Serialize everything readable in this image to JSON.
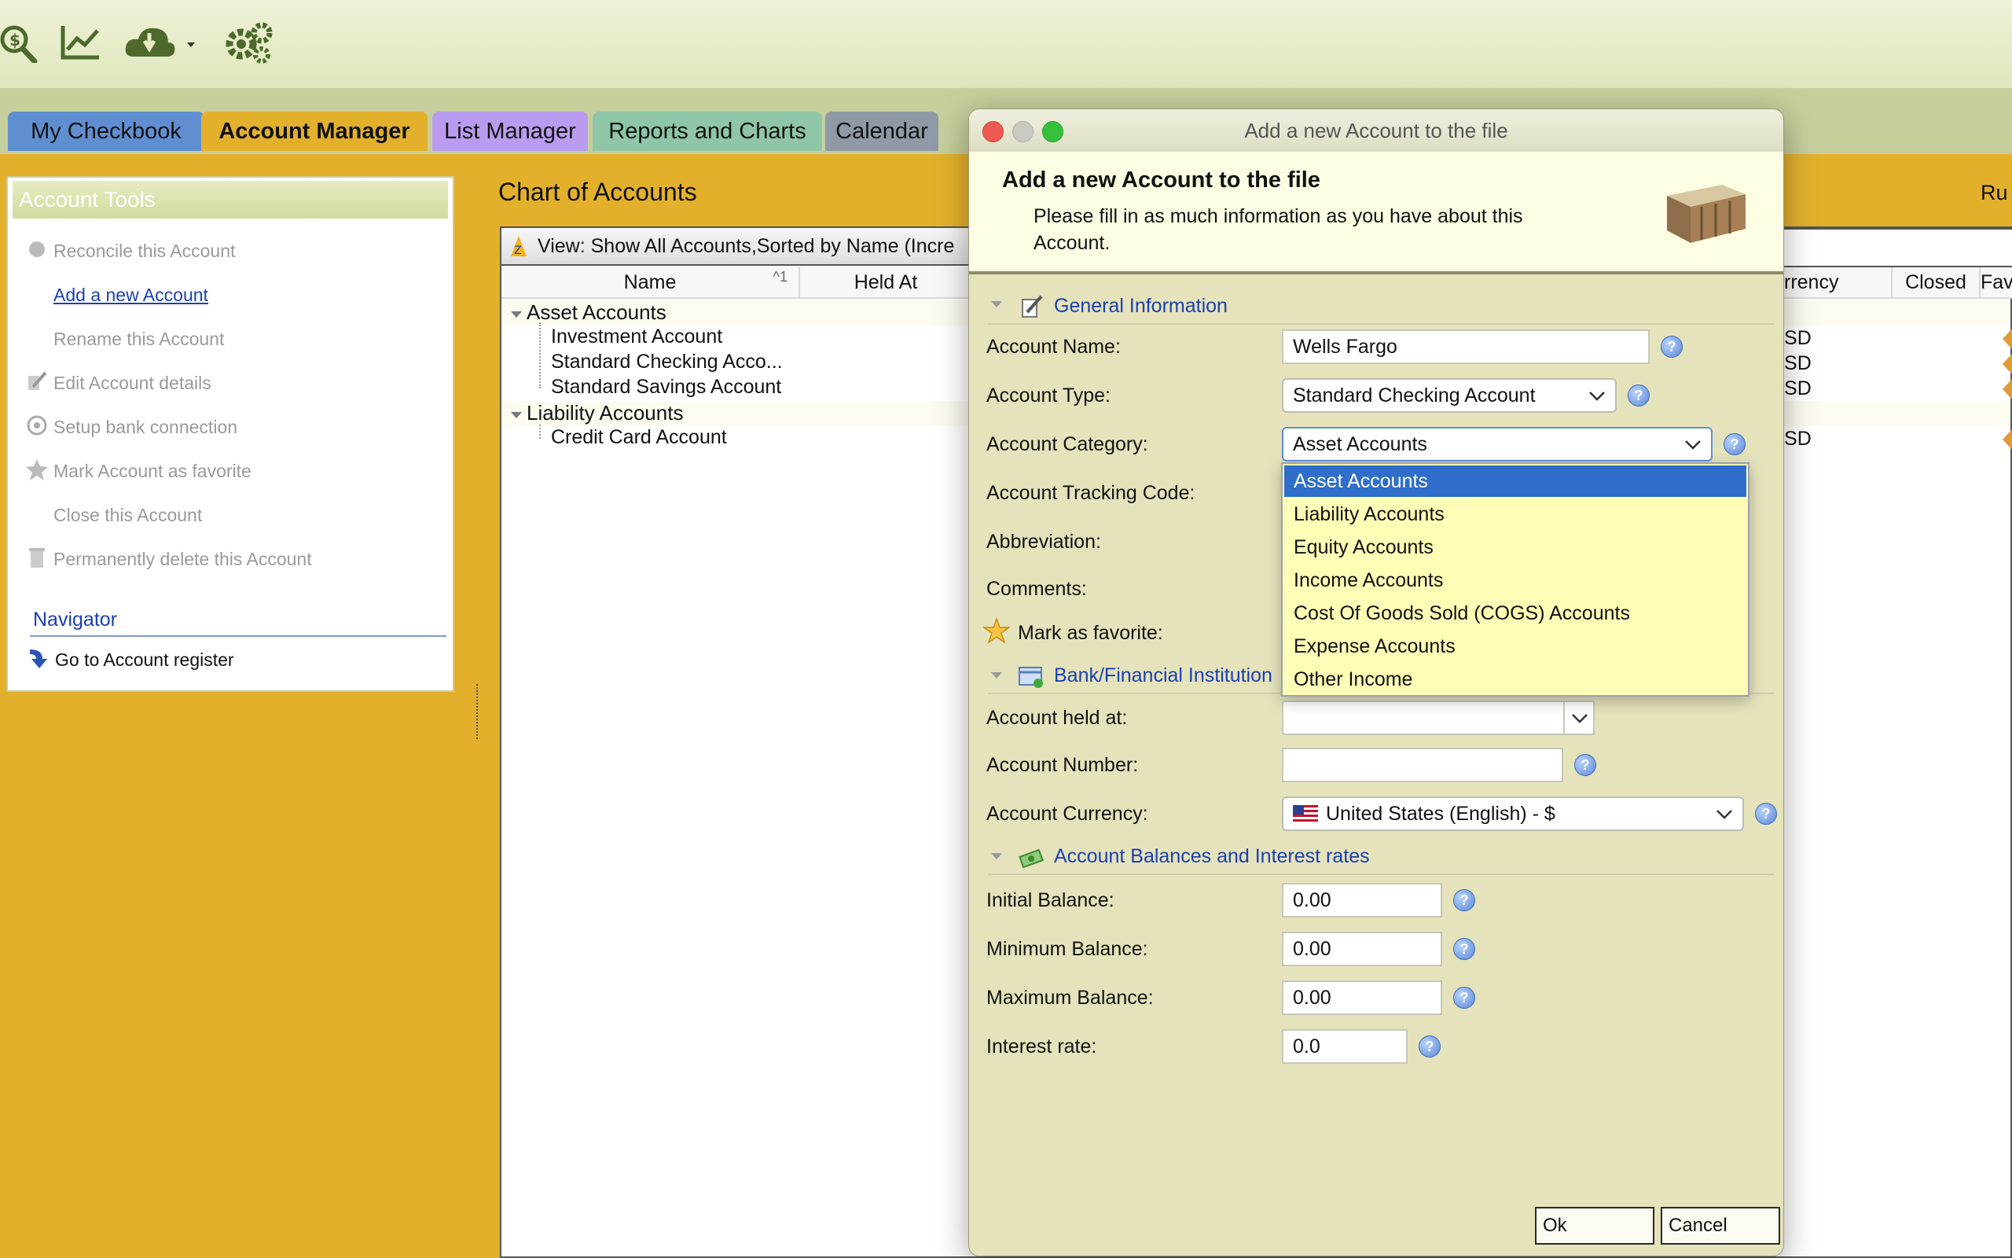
{
  "toolbar": {
    "icons": [
      "search-money-icon",
      "chart-line-icon",
      "cloud-download-icon",
      "gears-icon"
    ]
  },
  "tabs": [
    {
      "label": "My Checkbook"
    },
    {
      "label": "Account Manager"
    },
    {
      "label": "List Manager"
    },
    {
      "label": "Reports and Charts"
    },
    {
      "label": "Calendar"
    }
  ],
  "account_tools": {
    "header": "Account Tools",
    "items": [
      {
        "label": "Reconcile this Account"
      },
      {
        "label": "Add a new Account"
      },
      {
        "label": "Rename this Account"
      },
      {
        "label": "Edit Account details"
      },
      {
        "label": "Setup bank connection"
      },
      {
        "label": "Mark Account as favorite"
      },
      {
        "label": "Close this Account"
      },
      {
        "label": "Permanently delete this Account"
      }
    ],
    "navigator_header": "Navigator",
    "navigator_items": [
      {
        "label": "Go to Account register"
      }
    ]
  },
  "chart": {
    "title": "Chart of Accounts",
    "view_text": "View: Show All Accounts,Sorted by Name (Incre",
    "columns": {
      "name": "Name",
      "sort_indicator": "1",
      "held_at": "Held At",
      "currency": "rrency",
      "closed": "Closed",
      "favorite": "Fav"
    },
    "right_label": "Ru",
    "tree": [
      {
        "label": "Asset Accounts",
        "currency": ""
      },
      {
        "label": "Investment Account",
        "currency": "USD"
      },
      {
        "label": "Standard Checking Acco...",
        "currency": "USD"
      },
      {
        "label": "Standard Savings Account",
        "currency": "USD"
      },
      {
        "label": "Liability Accounts",
        "currency": ""
      },
      {
        "label": "Credit Card Account",
        "currency": "USD"
      }
    ]
  },
  "dialog": {
    "window_title": "Add a new Account to the file",
    "heading": "Add a new Account to the file",
    "subtext_line1": "Please fill in as much information as you have about this",
    "subtext_line2": "Account.",
    "sections": {
      "general": "General Information",
      "bank": "Bank/Financial Institution",
      "balances": "Account Balances and Interest rates"
    },
    "labels": {
      "account_name": "Account Name:",
      "account_type": "Account Type:",
      "account_category": "Account Category:",
      "tracking_code": "Account Tracking Code:",
      "abbreviation": "Abbreviation:",
      "comments": "Comments:",
      "favorite": "Mark as favorite:",
      "held_at": "Account held at:",
      "account_number": "Account Number:",
      "currency": "Account Currency:",
      "initial_balance": "Initial Balance:",
      "minimum_balance": "Minimum Balance:",
      "maximum_balance": "Maximum Balance:",
      "interest_rate": "Interest rate:"
    },
    "values": {
      "account_name": "Wells Fargo",
      "account_type": "Standard Checking Account",
      "account_category": "Asset Accounts",
      "held_at": "",
      "account_number": "",
      "currency": "United States (English) - $",
      "initial_balance": "0.00",
      "minimum_balance": "0.00",
      "maximum_balance": "0.00",
      "interest_rate": "0.0"
    },
    "category_options": [
      "Asset Accounts",
      "Liability Accounts",
      "Equity Accounts",
      "Income Accounts",
      "Cost Of Goods Sold (COGS) Accounts",
      "Expense Accounts",
      "Other Income"
    ],
    "selected_option": "Asset Accounts",
    "buttons": {
      "ok": "Ok",
      "cancel": "Cancel"
    }
  },
  "colors": {
    "background": "#e3b02c",
    "tab_active": "#e3b02c",
    "tab_list": "#b99cef",
    "tab_reports": "#8fc6a8",
    "tab_calendar": "#8f9aa6",
    "tab_checkbook": "#5f8fd0",
    "dropdown_bg": "#fefeb6",
    "dropdown_selected": "#2f6fcb",
    "link": "#1c3fb0"
  }
}
